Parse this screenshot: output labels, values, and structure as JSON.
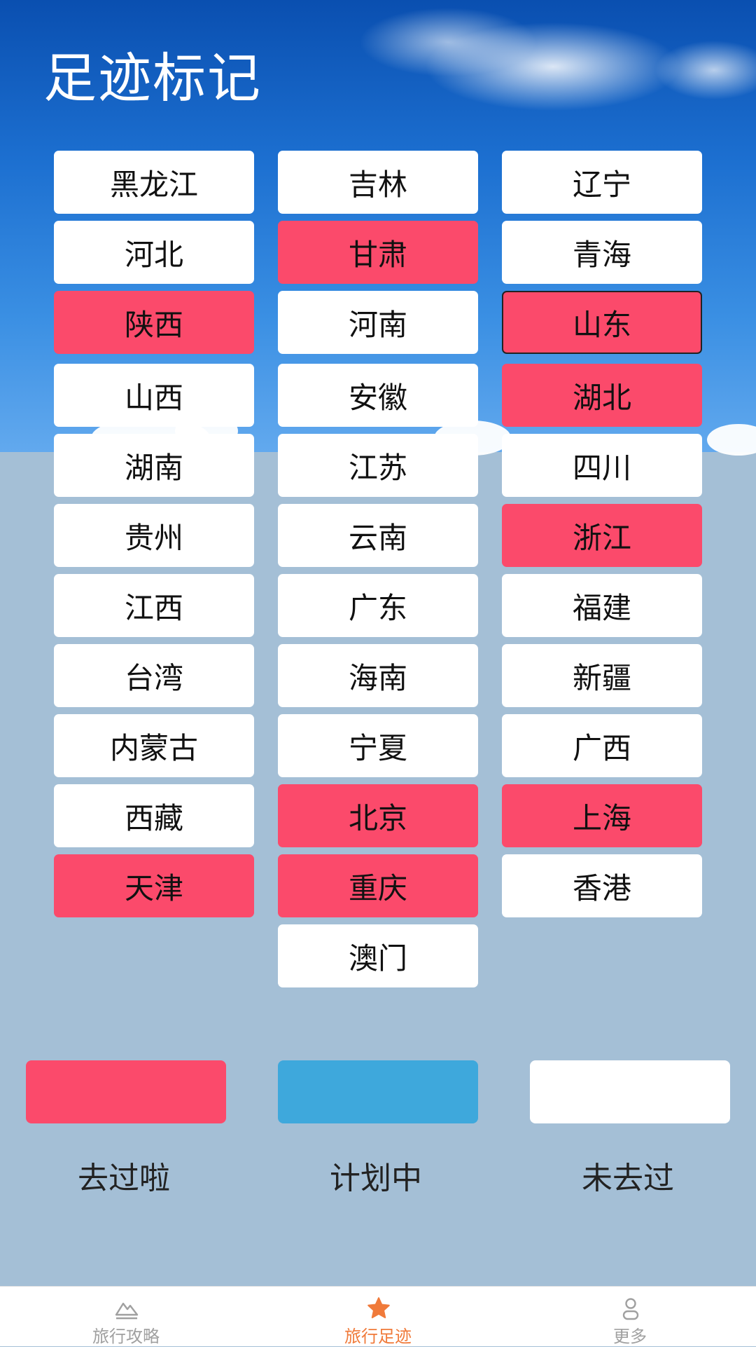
{
  "page": {
    "title": "足迹标记"
  },
  "provinces": [
    {
      "name": "黑龙江",
      "status": "none"
    },
    {
      "name": "吉林",
      "status": "none"
    },
    {
      "name": "辽宁",
      "status": "none"
    },
    {
      "name": "河北",
      "status": "none"
    },
    {
      "name": "甘肃",
      "status": "visited"
    },
    {
      "name": "青海",
      "status": "none"
    },
    {
      "name": "陕西",
      "status": "visited"
    },
    {
      "name": "河南",
      "status": "none"
    },
    {
      "name": "山东",
      "status": "visited",
      "focused": true
    },
    {
      "name": "山西",
      "status": "none"
    },
    {
      "name": "安徽",
      "status": "none"
    },
    {
      "name": "湖北",
      "status": "visited"
    },
    {
      "name": "湖南",
      "status": "none"
    },
    {
      "name": "江苏",
      "status": "none"
    },
    {
      "name": "四川",
      "status": "none"
    },
    {
      "name": "贵州",
      "status": "none"
    },
    {
      "name": "云南",
      "status": "none"
    },
    {
      "name": "浙江",
      "status": "visited"
    },
    {
      "name": "江西",
      "status": "none"
    },
    {
      "name": "广东",
      "status": "none"
    },
    {
      "name": "福建",
      "status": "none"
    },
    {
      "name": "台湾",
      "status": "none"
    },
    {
      "name": "海南",
      "status": "none"
    },
    {
      "name": "新疆",
      "status": "none"
    },
    {
      "name": "内蒙古",
      "status": "none"
    },
    {
      "name": "宁夏",
      "status": "none"
    },
    {
      "name": "广西",
      "status": "none"
    },
    {
      "name": "西藏",
      "status": "none"
    },
    {
      "name": "北京",
      "status": "visited"
    },
    {
      "name": "上海",
      "status": "visited"
    },
    {
      "name": "天津",
      "status": "visited"
    },
    {
      "name": "重庆",
      "status": "visited"
    },
    {
      "name": "香港",
      "status": "none"
    },
    {
      "name": "澳门",
      "status": "none"
    }
  ],
  "legend": [
    {
      "label": "去过啦",
      "color": "#fb4a6b"
    },
    {
      "label": "计划中",
      "color": "#3ea8dc"
    },
    {
      "label": "未去过",
      "color": "#ffffff"
    }
  ],
  "tabs": [
    {
      "label": "旅行攻略",
      "icon": "mountain-icon",
      "active": false
    },
    {
      "label": "旅行足迹",
      "icon": "star-icon",
      "active": true
    },
    {
      "label": "更多",
      "icon": "user-icon",
      "active": false
    }
  ],
  "colors": {
    "visited": "#fb4a6b",
    "planned": "#3ea8dc",
    "unvisited": "#ffffff",
    "accent": "#f07a3a"
  }
}
